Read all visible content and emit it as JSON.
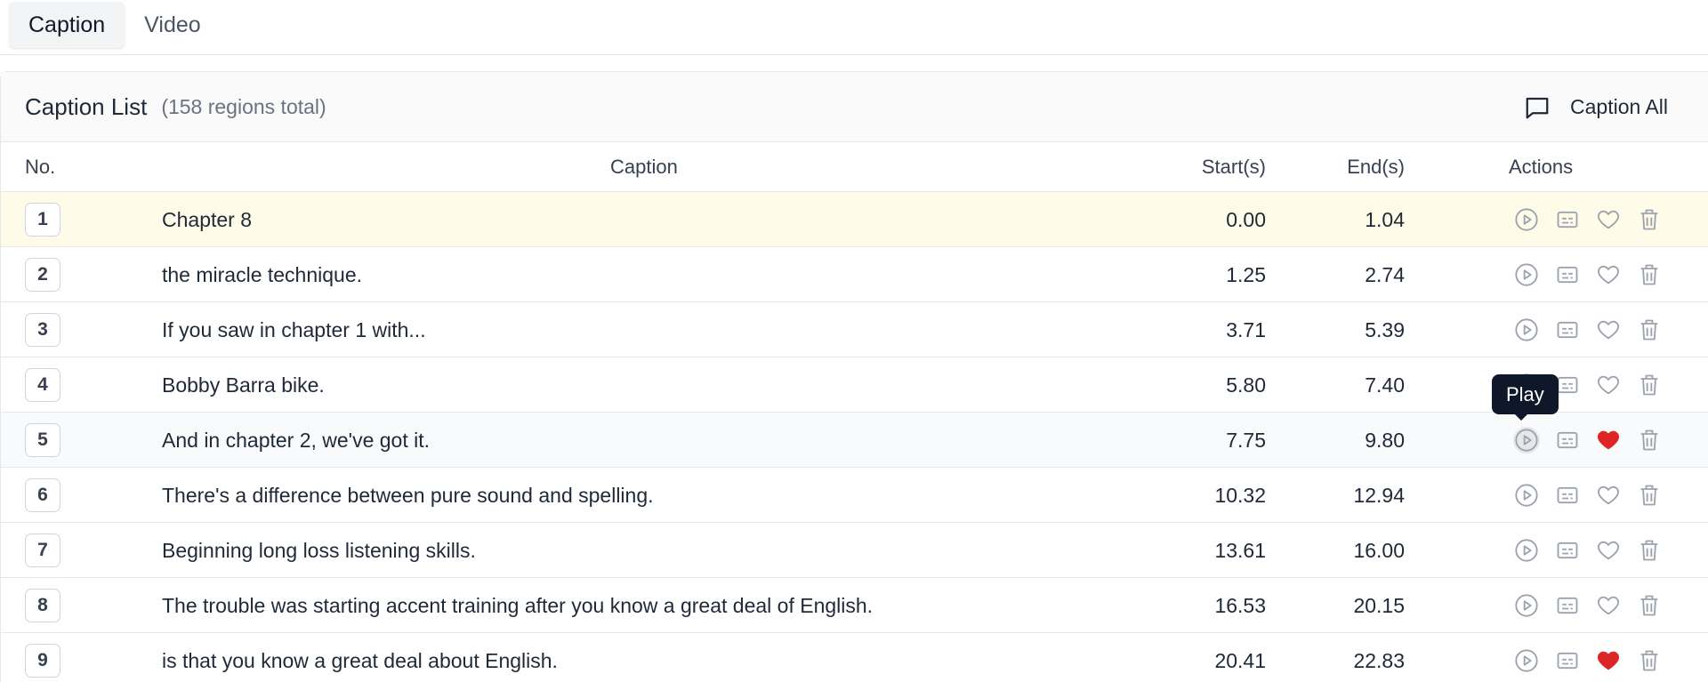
{
  "tabs": [
    {
      "label": "Caption",
      "active": true
    },
    {
      "label": "Video",
      "active": false
    }
  ],
  "panel": {
    "title": "Caption List",
    "count": "(158 regions total)",
    "caption_all_label": "Caption All"
  },
  "columns": {
    "no": "No.",
    "caption": "Caption",
    "start": "Start(s)",
    "end": "End(s)",
    "actions": "Actions"
  },
  "tooltip": "Play",
  "colors": {
    "favorite_active": "#dc2626",
    "icon_gray": "#9ca3af",
    "highlight_row": "#fefce8"
  },
  "rows": [
    {
      "no": "1",
      "caption": "Chapter 8",
      "start": "0.00",
      "end": "1.04",
      "favorite": false
    },
    {
      "no": "2",
      "caption": "the miracle technique.",
      "start": "1.25",
      "end": "2.74",
      "favorite": false
    },
    {
      "no": "3",
      "caption": "If you saw in chapter 1 with...",
      "start": "3.71",
      "end": "5.39",
      "favorite": false
    },
    {
      "no": "4",
      "caption": "Bobby Barra bike.",
      "start": "5.80",
      "end": "7.40",
      "favorite": false
    },
    {
      "no": "5",
      "caption": "And in chapter 2, we've got it.",
      "start": "7.75",
      "end": "9.80",
      "favorite": true
    },
    {
      "no": "6",
      "caption": "There's a difference between pure sound and spelling.",
      "start": "10.32",
      "end": "12.94",
      "favorite": false
    },
    {
      "no": "7",
      "caption": "Beginning long loss listening skills.",
      "start": "13.61",
      "end": "16.00",
      "favorite": false
    },
    {
      "no": "8",
      "caption": "The trouble was starting accent training after you know a great deal of English.",
      "start": "16.53",
      "end": "20.15",
      "favorite": false
    },
    {
      "no": "9",
      "caption": "is that you know a great deal about English.",
      "start": "20.41",
      "end": "22.83",
      "favorite": true
    }
  ]
}
